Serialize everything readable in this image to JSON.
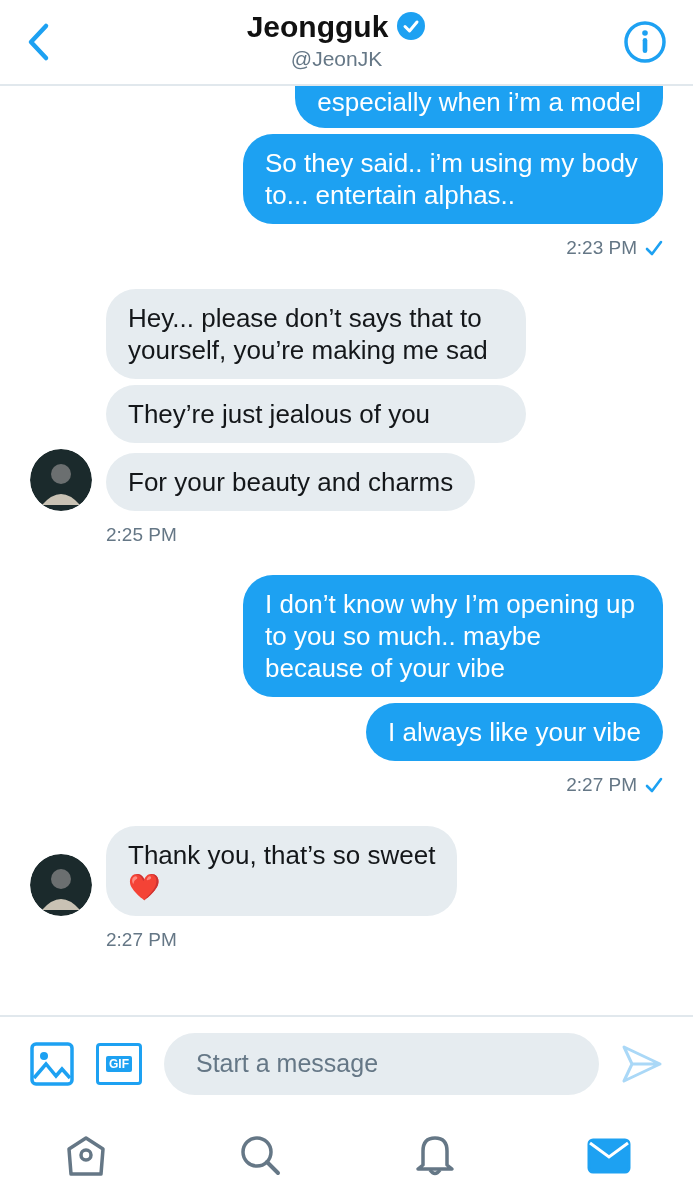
{
  "header": {
    "name": "Jeongguk",
    "verified": true,
    "handle": "@JeonJK"
  },
  "groups": [
    {
      "kind": "outgoing",
      "bubbles": [
        "especially when i’m a model",
        "So they said.. i’m using my body to... entertain alphas.."
      ],
      "time": "2:23 PM",
      "read": true
    },
    {
      "kind": "incoming",
      "bubbles": [
        "Hey... please don’t says that to yourself, you’re making me sad",
        "They’re just jealous of you",
        "For your beauty and charms"
      ],
      "time": "2:25 PM"
    },
    {
      "kind": "outgoing",
      "bubbles": [
        "I don’t know why I’m opening up to you so much.. maybe because of your vibe",
        "I always like your vibe"
      ],
      "time": "2:27 PM",
      "read": true
    },
    {
      "kind": "incoming",
      "bubbles": [
        "Thank you, that’s so sweet\n❤️"
      ],
      "time": "2:27 PM"
    }
  ],
  "compose": {
    "gif_label": "GIF",
    "placeholder": "Start a message"
  },
  "tabs": [
    {
      "kind": "home",
      "selected": false
    },
    {
      "kind": "search",
      "selected": false
    },
    {
      "kind": "notifications",
      "selected": false
    },
    {
      "kind": "messages",
      "selected": true
    }
  ]
}
